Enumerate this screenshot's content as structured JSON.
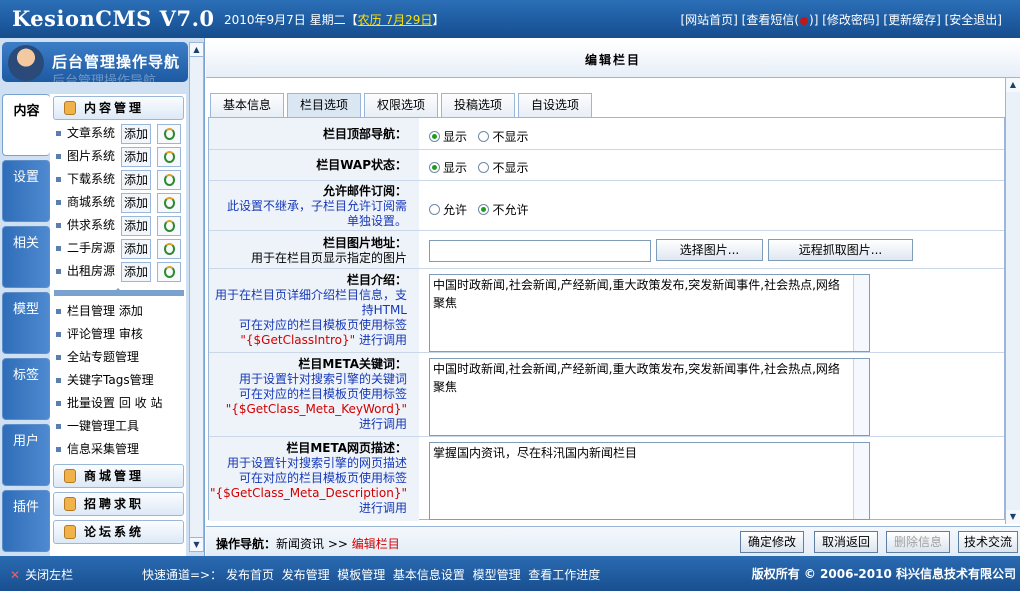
{
  "header": {
    "logo": "KesionCMS V7.0",
    "date": "2010年9月7日 星期二【",
    "lunar": "农历 7月29日",
    "date_end": "】",
    "links": {
      "home": "[网站首页]",
      "sms_pre": "[查看短信(",
      "sms_post": ")]",
      "password": "[修改密码]",
      "cache": "[更新缓存]",
      "logout": "[安全退出]"
    }
  },
  "sidebar": {
    "title": "后台管理操作导航",
    "title_ghost": "后台管理操作导航",
    "vtabs": [
      "内容",
      "设置",
      "相关",
      "模型",
      "标签",
      "用户",
      "插件"
    ],
    "content_header": "内容管理",
    "systems": [
      {
        "label": "文章系统",
        "add": "添加"
      },
      {
        "label": "图片系统",
        "add": "添加"
      },
      {
        "label": "下载系统",
        "add": "添加"
      },
      {
        "label": "商城系统",
        "add": "添加"
      },
      {
        "label": "供求系统",
        "add": "添加"
      },
      {
        "label": "二手房源",
        "add": "添加"
      },
      {
        "label": "出租房源",
        "add": "添加"
      }
    ],
    "tools": [
      "栏目管理 添加",
      "评论管理 审核",
      "全站专题管理",
      "关键字Tags管理",
      "批量设置 回 收 站",
      "一键管理工具",
      "信息采集管理"
    ],
    "sections": [
      "商城管理",
      "招聘求职",
      "论坛系统"
    ]
  },
  "main": {
    "title": "编辑栏目",
    "tabs": [
      "基本信息",
      "栏目选项",
      "权限选项",
      "投稿选项",
      "自设选项"
    ],
    "active_tab": "栏目选项",
    "fields": {
      "top_nav": {
        "label": "栏目顶部导航：",
        "options": [
          "显示",
          "不显示"
        ],
        "selected": "显示"
      },
      "wap": {
        "label": "栏目WAP状态：",
        "options": [
          "显示",
          "不显示"
        ],
        "selected": "显示"
      },
      "mail": {
        "label": "允许邮件订阅：",
        "desc": "此设置不继承，子栏目允许订阅需单独设置。",
        "options": [
          "允许",
          "不允许"
        ],
        "selected": "不允许"
      },
      "image": {
        "label": "栏目图片地址：",
        "desc": "用于在栏目页显示指定的图片",
        "value": "",
        "select_btn": "选择图片...",
        "remote_btn": "远程抓取图片..."
      },
      "intro": {
        "label": "栏目介绍：",
        "desc1": "用于在栏目页详细介绍栏目信息，支持HTML",
        "desc2": "可在对应的栏目模板页使用标签",
        "tag": "\"{$GetClassIntro}\"",
        "desc3": "进行调用",
        "value": "中国时政新闻,社会新闻,产经新闻,重大政策发布,突发新闻事件,社会热点,网络聚焦"
      },
      "keywords": {
        "label": "栏目META关键词：",
        "desc1": "用于设置针对搜索引擎的关键词",
        "desc2": "可在对应的栏目模板页使用标签",
        "tag": "\"{$GetClass_Meta_KeyWord}\"",
        "desc3": "进行调用",
        "value": "中国时政新闻,社会新闻,产经新闻,重大政策发布,突发新闻事件,社会热点,网络聚焦"
      },
      "description": {
        "label": "栏目META网页描述：",
        "desc1": "用于设置针对搜索引擎的网页描述",
        "desc2": "可在对应的栏目模板页使用标签",
        "tag": "\"{$GetClass_Meta_Description}\"",
        "desc3": "进行调用",
        "value": "掌握国内资讯，尽在科汛国内新闻栏目"
      }
    },
    "op_nav": {
      "label": "操作导航：",
      "path": "新闻资讯",
      "sep": " >> ",
      "current": "编辑栏目"
    },
    "buttons": {
      "confirm": "确定修改",
      "cancel": "取消返回",
      "delete": "删除信息",
      "support": "技术交流"
    }
  },
  "footer": {
    "close": "关闭左栏",
    "quick_label": "快速通道=>：",
    "quick_links": [
      "发布首页",
      "发布管理",
      "模板管理",
      "基本信息设置",
      "模型管理",
      "查看工作进度"
    ],
    "copyright": "版权所有 © 2006-2010 科兴信息技术有限公司"
  }
}
